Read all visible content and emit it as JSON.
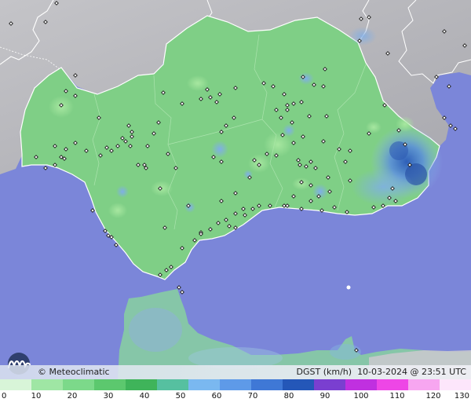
{
  "map": {
    "brand": "© Meteoclimatic",
    "parameter": "DGST (km/h)",
    "datetime": "10-03-2024 @ 23:51 UTC",
    "colors": {
      "sea": "#7b86d9",
      "land_outside": "#b9b9bd",
      "andalusia": "#7fcf86",
      "morocco_land": "#86c6a8",
      "border_line": "#ffffff",
      "station_marker": "#1a1a1a"
    }
  },
  "legend": {
    "ticks": [
      "0",
      "10",
      "20",
      "30",
      "40",
      "50",
      "60",
      "70",
      "80",
      "90",
      "100",
      "110",
      "120",
      "130"
    ],
    "colors": [
      "#d8f5d8",
      "#9fe6a4",
      "#7cd98a",
      "#5cc86e",
      "#3fb45a",
      "#56c0a0",
      "#7ab8f0",
      "#5e9ae8",
      "#3f78d6",
      "#2457b8",
      "#7a3fd0",
      "#c030e0",
      "#ee46e6",
      "#f7a6f0",
      "#fde6fb"
    ]
  }
}
